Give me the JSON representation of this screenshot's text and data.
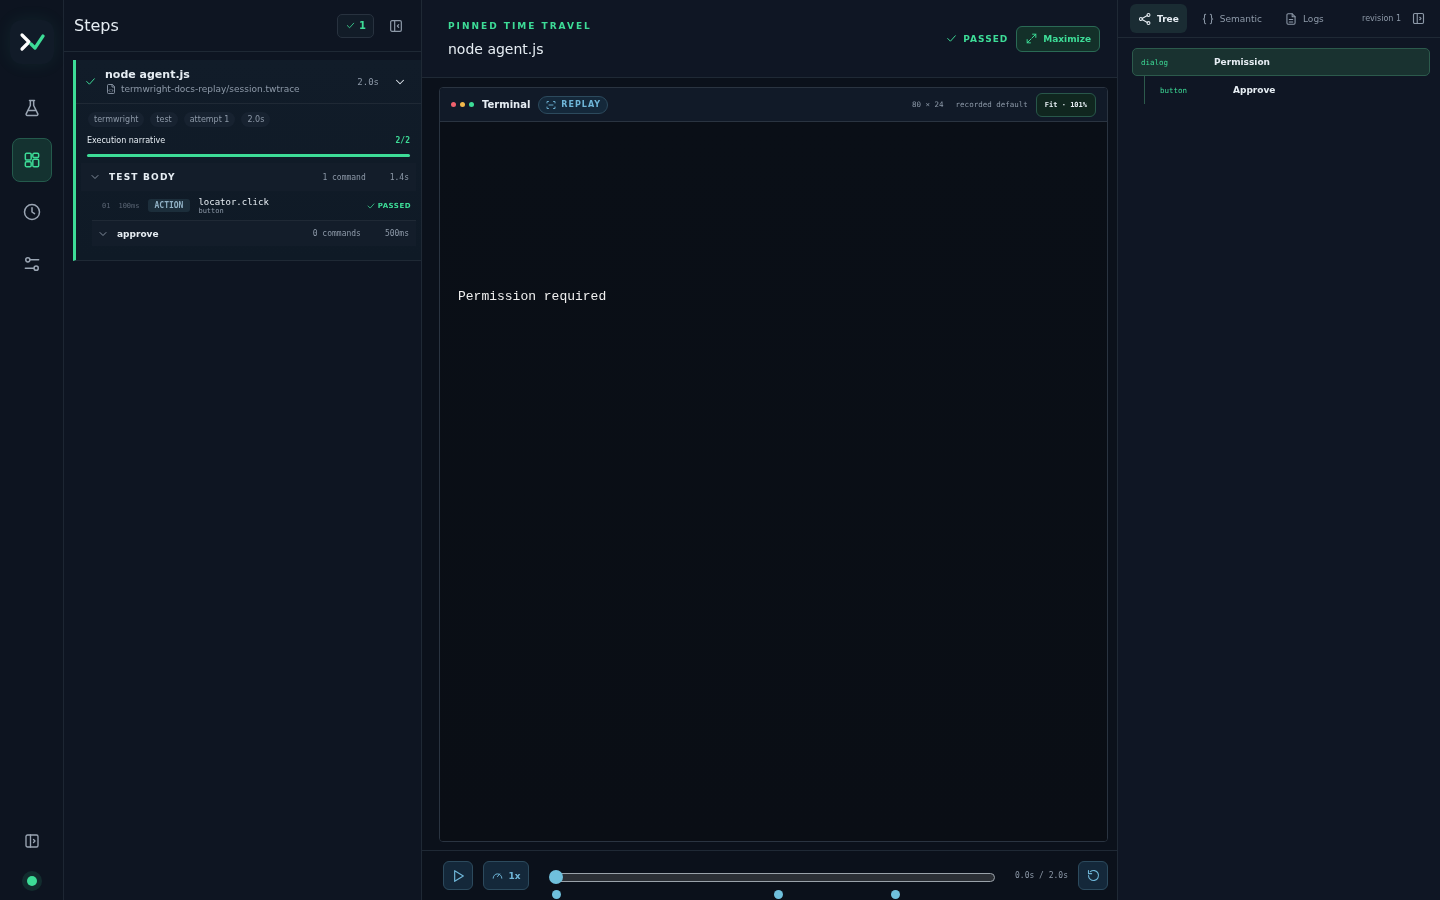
{
  "rail": {
    "items": [
      {
        "kind": "flask",
        "selected": false
      },
      {
        "kind": "grid",
        "selected": true
      },
      {
        "kind": "clock",
        "selected": false
      },
      {
        "kind": "sliders",
        "selected": false
      }
    ],
    "status": {
      "color": "#3ddc97"
    }
  },
  "steps": {
    "title": "Steps",
    "passed_count": "1",
    "run": {
      "title": "node agent.js",
      "file": "termwright-docs-replay/session.twtrace",
      "duration": "2.0s",
      "expanded": true,
      "tags": [
        "termwright",
        "test",
        "attempt 1",
        "2.0s"
      ],
      "narrative": {
        "label": "Execution narrative",
        "count": "2/2",
        "level": 1
      },
      "groups": [
        {
          "title": "TEST BODY",
          "kind": "section",
          "expanded": true,
          "meta": "1 command",
          "duration": "1.4s",
          "commands": [
            {
              "index": "01",
              "time": "100ms",
              "badge": "ACTION",
              "name": "locator.click",
              "target": "button",
              "status": "PASSED"
            }
          ]
        },
        {
          "title": "approve",
          "kind": "sub",
          "expanded": true,
          "meta": "0 commands",
          "duration": "500ms"
        }
      ]
    }
  },
  "center": {
    "eyebrow": "PINNED TIME TRAVEL",
    "title": "node agent.js",
    "status": "PASSED",
    "maximize": "Maximize",
    "terminal": {
      "title": "Terminal",
      "badge": "REPLAY",
      "size": "80 × 24",
      "profile": "recorded default",
      "zoom": "Fit · 101%",
      "lines": [
        "Permission required"
      ]
    },
    "playback": {
      "speed": "1x",
      "level": 0,
      "time": "0.0s / 2.0s",
      "markers": [
        {
          "level": 0
        },
        {
          "level": 0.507
        },
        {
          "level": 0.775
        }
      ]
    }
  },
  "inspector": {
    "tabs": [
      {
        "label": "Tree",
        "kind": "tree",
        "selected": true
      },
      {
        "label": "Semantic",
        "kind": "braces",
        "selected": false
      },
      {
        "label": "Logs",
        "kind": "doc",
        "selected": false
      }
    ],
    "revision": "revision 1",
    "tree": [
      {
        "role": "dialog",
        "name": "Permission",
        "selected": true,
        "children": [
          {
            "role": "button",
            "name": "Approve",
            "selected": false
          }
        ]
      }
    ]
  }
}
